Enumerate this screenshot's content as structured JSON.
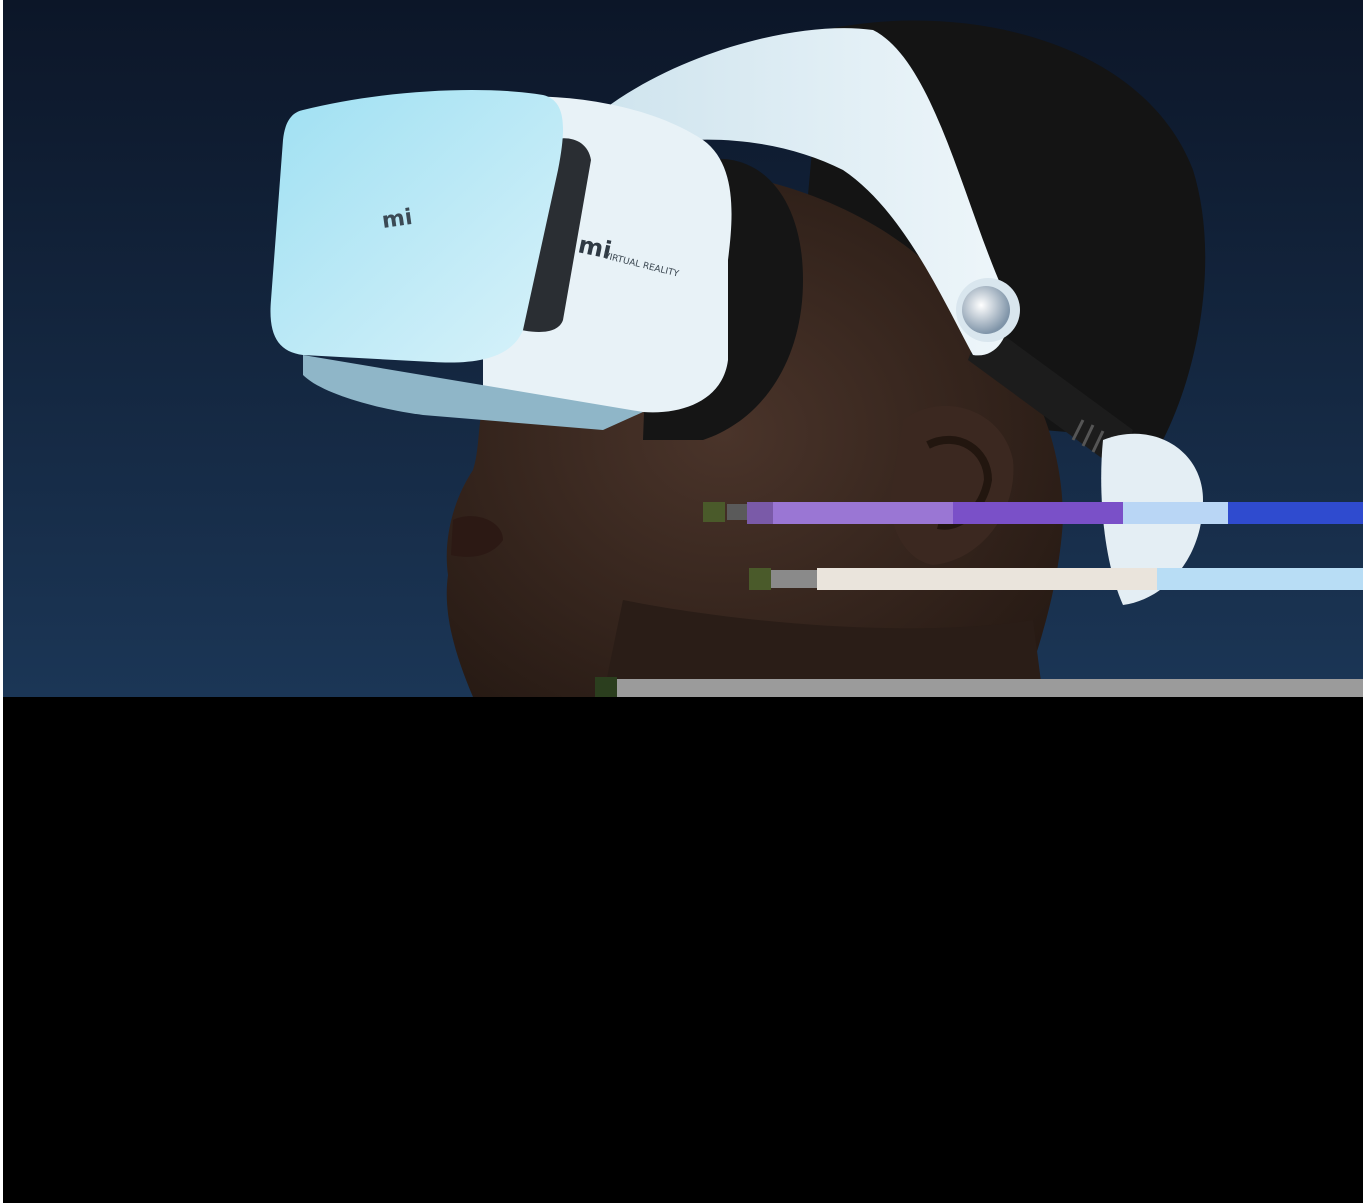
{
  "headset": {
    "front_logo": "mi",
    "side_logo": "mi",
    "side_text": "VIRTUAL REALITY"
  },
  "colors": {
    "background_top": "#0e1a2e",
    "background_bottom": "#1a3352",
    "headset_light": "#b9e7f4",
    "headset_white": "#e6f1f7",
    "skin": "#3a2a22",
    "hair": "#121212",
    "strap": "#1a1a1a",
    "glitch_purple": "#9a6fd8",
    "glitch_blue": "#2f4bcf",
    "glitch_gray": "#9b9b9b"
  }
}
